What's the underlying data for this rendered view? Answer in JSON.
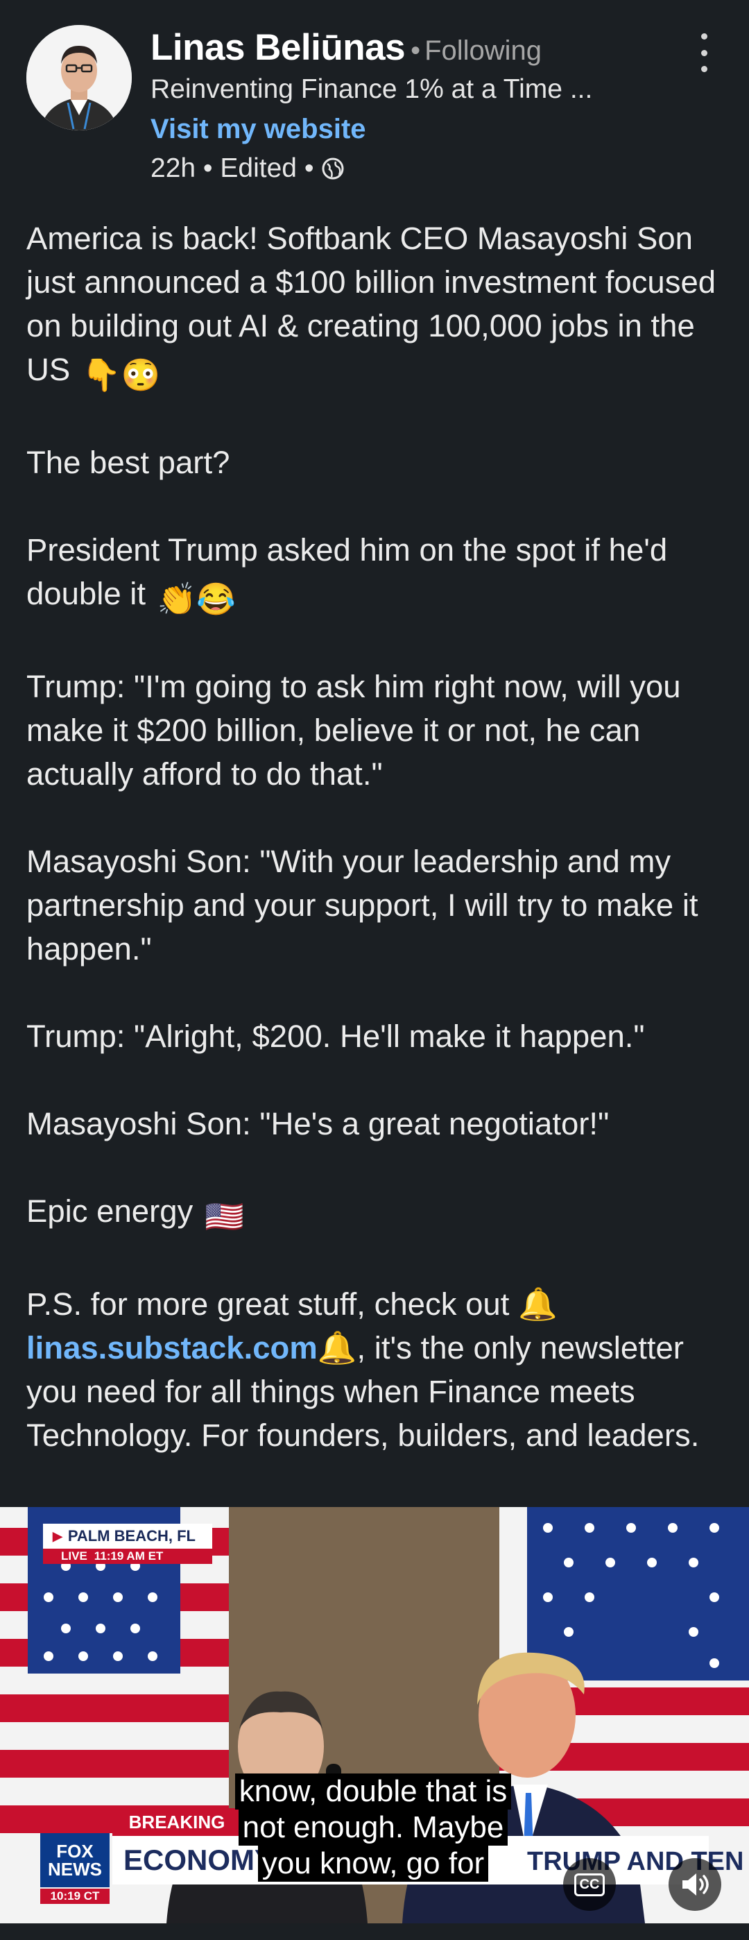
{
  "author": {
    "name": "Linas Beliūnas",
    "follow_status": "Following",
    "separator": "•",
    "tagline": "Reinventing Finance 1% at a Time ...",
    "website_link": "Visit my website",
    "meta": "22h • Edited •",
    "visibility_icon": "globe-icon",
    "more_icon": "more-vertical-icon"
  },
  "post": {
    "p1": "America is back! Softbank CEO Masayoshi Son just announced a $100 billion investment focused on building out AI & creating 100,000 jobs in the US",
    "p1_emoji": [
      "👇",
      "😳"
    ],
    "p2": "The best part?",
    "p3": "President Trump asked him on the spot if he'd double it",
    "p3_emoji": [
      "👏",
      "😂"
    ],
    "p4": "Trump: \"I'm going to ask him right now, will you make it $200 billion, believe it or not, he can actually afford to do that.\"",
    "p5": "Masayoshi Son: \"With your leadership and my partnership and your support, I will try to make it happen.\"",
    "p6": "Trump: \"Alright, $200. He'll make it happen.\"",
    "p7": "Masayoshi Son: \"He's a great negotiator!\"",
    "p8": "Epic energy",
    "p8_emoji": "🇺🇸",
    "p9_before": "P.S. for more great stuff, check out",
    "p9_emoji": "🔔",
    "p9_link": "linas.substack.com",
    "p9_after": ", it's the only newsletter you need for all things when Finance meets Technology. For founders, builders, and leaders."
  },
  "video": {
    "location": "PALM BEACH, FL",
    "live": "LIVE",
    "live_time": "11:19 AM ET",
    "breaking": "BREAKING",
    "ticker_left": "ECONOMY",
    "ticker_right": "TRUMP AND TEN",
    "network_line1": "FOX",
    "network_line2": "NEWS",
    "network_time": "10:19 CT",
    "caption_lines": [
      "know, double that is",
      "not enough. Maybe",
      "you know, go for"
    ],
    "cc_label": "CC",
    "colors": {
      "flag_red": "#c8102e",
      "flag_blue": "#1c3a8a",
      "fox_blue": "#0b3a8a"
    }
  }
}
